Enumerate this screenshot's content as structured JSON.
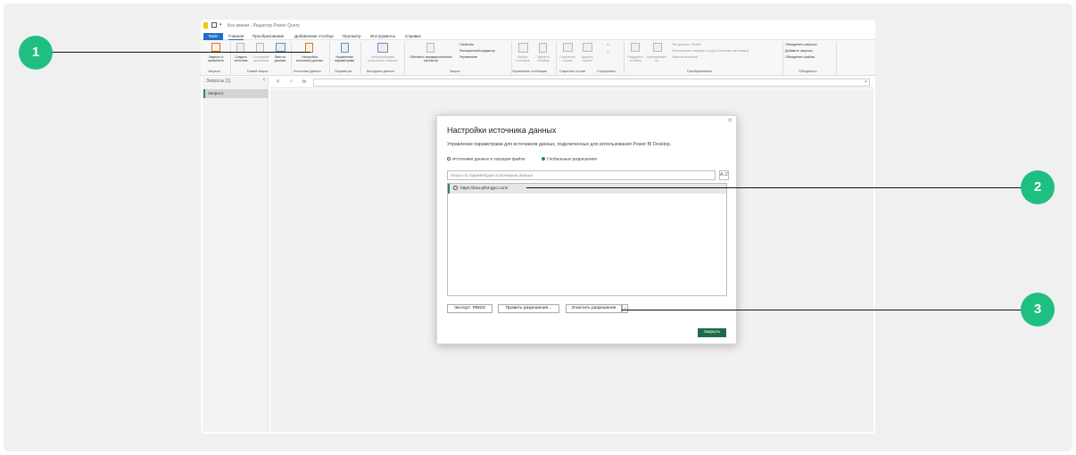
{
  "window": {
    "title": "Без имени - Редактор Power Query"
  },
  "tabs": [
    "Файл",
    "Главная",
    "Преобразование",
    "Добавление столбца",
    "Просмотр",
    "Инструменты",
    "Справка"
  ],
  "ribbon": {
    "close_apply": "Закрыть и",
    "close_apply2": "применить",
    "new_source": "Создать",
    "new_source2": "источник",
    "recent": "Последние",
    "recent2": "источники",
    "enter_data": "Ввести",
    "enter_data2": "данные",
    "ds_settings": "Настройки",
    "ds_settings2": "источника данных",
    "manage_params": "Управление",
    "manage_params2": "параметрами",
    "export_results": "Экспортировать",
    "export_results2": "результаты запроса",
    "refresh_preview": "Обновить предварительный",
    "refresh_preview2": "просмотр",
    "properties": "Свойства",
    "advanced_editor": "Расширенный редактор",
    "manage": "Управление",
    "choose_cols": "Выбор",
    "choose_cols2": "столбцов",
    "remove_cols": "Удалить",
    "remove_cols2": "столбцы",
    "keep_rows": "Сохранить",
    "keep_rows2": "строки",
    "remove_rows": "Удалить",
    "remove_rows2": "строки",
    "split_col": "Разделить",
    "split_col2": "столбец",
    "group_by": "Группировать",
    "group_by2": "по",
    "data_type": "Тип данных: Любой",
    "first_row": "Использовать первую строку в качестве заголовков",
    "replace_values": "Замена значений",
    "merge_queries": "Объединить запросы",
    "append_queries": "Добавить запросы",
    "combine_files": "Объединить файлы",
    "groups": {
      "close": "Закрыть",
      "new_query": "Новый запрос",
      "data_sources": "Источники данных",
      "parameters": "Параметры",
      "output": "Выходные данные",
      "query": "Запрос",
      "manage_cols": "Управление столбцами",
      "reduce_rows": "Сократить строки",
      "sort": "Сортировать",
      "transform": "Преобразование",
      "combine": "Объединить"
    }
  },
  "queries_pane": {
    "header": "Запросы [1]",
    "items": [
      "Запрос1"
    ]
  },
  "formula_bar": {
    "fx": "fx"
  },
  "dialog": {
    "title": "Настройки источника данных",
    "description": "Управление параметрами для источников данных, подключенных для использования Power BI Desktop.",
    "radio_current": "Источники данных в текущем файле",
    "radio_global": "Глобальные разрешения",
    "search_placeholder": "Поиск по параметрам источников данных",
    "sort_label": "A↓Z",
    "sources": [
      "https://ksa-pilot-gpo.com/"
    ],
    "buttons": {
      "export": "Экспорт: PBIDS",
      "edit": "Править разрешения...",
      "clear": "Очистить разрешения",
      "close": "Закрыть"
    }
  },
  "callouts": [
    "1",
    "2",
    "3"
  ],
  "colors": {
    "accent": "#1fbf82",
    "primary_button": "#1e6b4a",
    "file_tab": "#1e6fc5"
  }
}
